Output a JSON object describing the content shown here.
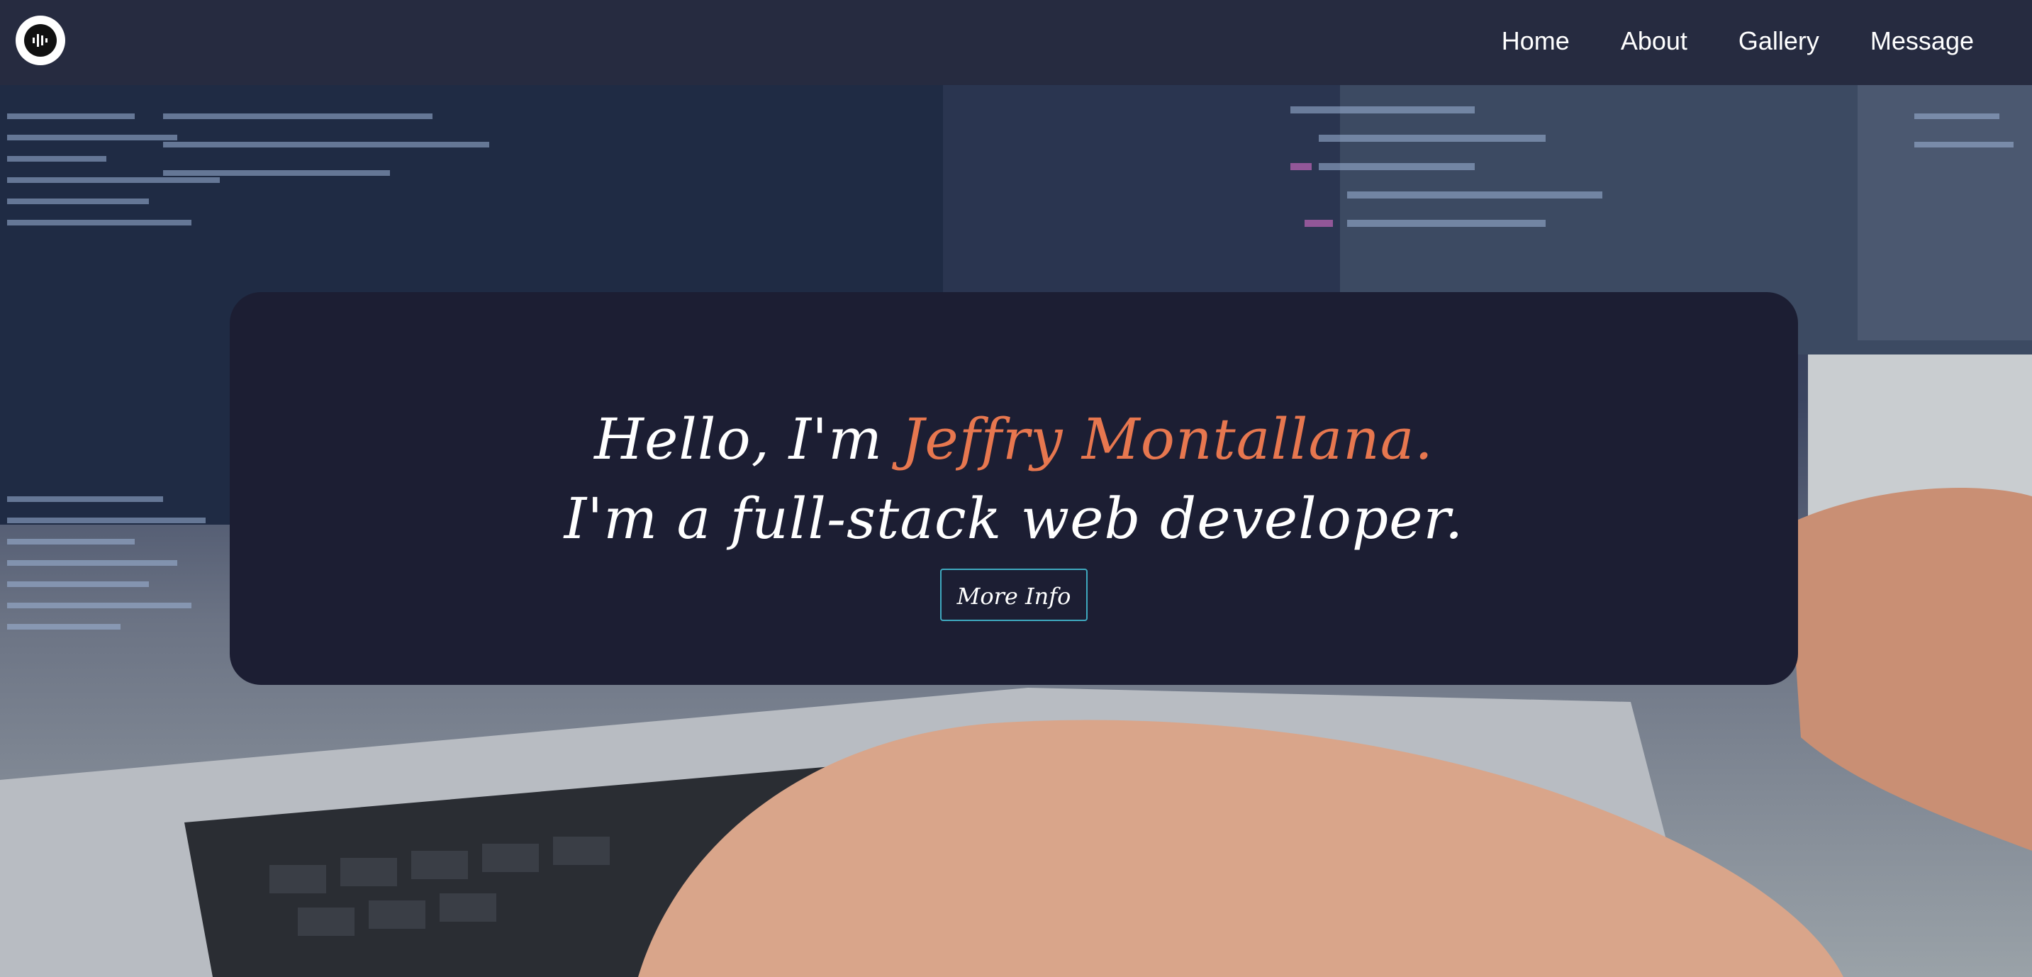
{
  "nav": {
    "logo_icon": "sound-wave-icon",
    "links": [
      "Home",
      "About",
      "Gallery",
      "Message"
    ]
  },
  "hero": {
    "greeting": "Hello, I'm ",
    "name": "Jeffry Montallana.",
    "tagline": "I'm a full-stack web developer.",
    "button_label": "More Info"
  },
  "colors": {
    "navbar": "#262b40",
    "card": "#1c1e33",
    "accent_name": "#e7774f",
    "button_border": "#3fa9bf"
  }
}
